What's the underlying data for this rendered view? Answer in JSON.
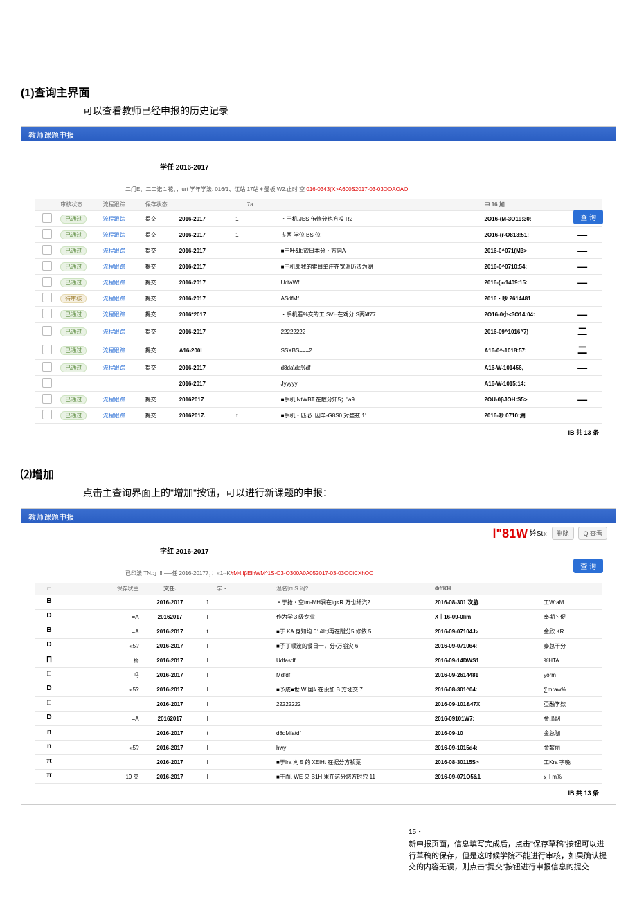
{
  "section1": {
    "num": "(1)查询主界面",
    "sub": "可以查看教师已经申报的历史记录"
  },
  "section2": {
    "num": "⑵增加",
    "sub": "点击主查询界面上的\"增加\"按钮，可以进行新课题的申报："
  },
  "panel": {
    "title": "教师课题申报",
    "semester": "学任 2016-2017",
    "queryBtn": "查 询",
    "note_pre": "二门E、二二诺１花、，urt 学年学法. 016/1、江站 17站＊曼板!W2.止时 空 ",
    "note_hl": "016-0343(X>A600S2017-03-03OOAOAO",
    "footer": "IB 共 13 条"
  },
  "thead1": [
    "",
    "审核状态",
    "流程跟踪",
    "保存状态",
    "",
    "",
    "7a",
    "",
    "",
    "中 16 加",
    ""
  ],
  "rows1": [
    {
      "audit": "已通过",
      "track": "流程跟踪",
      "save": "提交",
      "year": "2016-2017",
      "n": "1",
      "topic": "・干机.JES 侑修分也方哎 R2",
      "date": "2O16-(M-3O19:30:",
      "mark": "—"
    },
    {
      "audit": "已通过",
      "track": "流程跟踪",
      "save": "提交",
      "year": "2016-2017",
      "n": "1",
      "topic": "丧两 学位 BS 位",
      "date": "2O16-(r-O813:51;",
      "mark": "—"
    },
    {
      "audit": "已通过",
      "track": "流程跟踪",
      "save": "提交",
      "year": "2016-2017",
      "n": "I",
      "topic": "■于叶&lt;欲日本分・方向A",
      "date": "2016-0^071(M3>",
      "mark": "—"
    },
    {
      "audit": "已通过",
      "track": "流程跟踪",
      "save": "提交",
      "year": "2016-2017",
      "n": "I",
      "topic": "■干机郎我的索目单庄在宽源历法为湖",
      "date": "2016-0^0710:54:",
      "mark": "—"
    },
    {
      "audit": "已通过",
      "track": "流程跟踪",
      "save": "提交",
      "year": "2016-2017",
      "n": "I",
      "topic": "UdfaWf",
      "date": "2016-(«-1409:15:",
      "mark": "—"
    },
    {
      "audit": "待审核",
      "track": "流程跟踪",
      "save": "提交",
      "year": "2016-2017",
      "n": "I",
      "topic": "ASdfMf",
      "date": "2016・吵 2614481",
      "mark": ""
    },
    {
      "audit": "已通过",
      "track": "流程跟踪",
      "save": "提交",
      "year": "2016*2017",
      "n": "I",
      "topic": "・手机看%交的工 SVH在戏分 S丙¥f77",
      "date": "2O16-0小<3O14:04:",
      "mark": "—"
    },
    {
      "audit": "已通过",
      "track": "流程跟踪",
      "save": "提交",
      "year": "2016-2017",
      "n": "I",
      "topic": "22222222",
      "date": "2016-09^1016^7)",
      "mark": "二"
    },
    {
      "audit": "已通过",
      "track": "流程跟踪",
      "save": "提交",
      "year": "A16-200I",
      "n": "I",
      "topic": "SSXBS===2",
      "date": "A16-0^-1018:57:",
      "mark": "二"
    },
    {
      "audit": "已通过",
      "track": "流程跟踪",
      "save": "提交",
      "year": "2016-2017",
      "n": "I",
      "topic": "d8da\\da%df",
      "date": "A16-W-101456,",
      "mark": "—"
    },
    {
      "audit": "",
      "track": "",
      "save": "",
      "year": "2016-2017",
      "n": "I",
      "topic": "Jyyyyy",
      "date": "A16-W-1015:14:",
      "mark": ""
    },
    {
      "audit": "已通过",
      "track": "流程跟踪",
      "save": "提交",
      "year": "20162017",
      "n": "I",
      "topic": "■手机.NtWBT.在散分知5；\"a9",
      "date": "2OU-0βJOH:S5>",
      "mark": "—"
    },
    {
      "audit": "已通过",
      "track": "流程跟踪",
      "save": "提交",
      "year": "20162017.",
      "n": "t",
      "topic": "■手机・匹必. 因羊-G8S0 对整兹 11",
      "date": "2016-吵 0710:湖",
      "mark": ""
    }
  ],
  "panel2": {
    "topbig": "l\"81W",
    "topsmall": "妗St«",
    "btn_del": "删除",
    "btn_view": "查看",
    "semester": "字红 2016-2017",
    "note_pre": "已印法 TN.:」!! ──任 2016-20177；：«1--K",
    "note_hl": "#MΦIβElhWM^1S-O3-O300A0A052017-03-03OOiCXhOO"
  },
  "thead2": [
    "□",
    "",
    "保存状主",
    "文任.",
    "",
    "学・",
    "温名师 S 闷?",
    "ΦffKH",
    ""
  ],
  "rows2": [
    {
      "c": "B",
      "s": "",
      "y": "2016-2017",
      "n": "1",
      "t": "・于抢・空tm-MH涧在tg<R 万也纤汽2",
      "d": "2016-08-301 次胁",
      "w": "工WraM"
    },
    {
      "c": "D",
      "s": "=A",
      "y": "20162017",
      "n": "I",
      "t": "作为学３级专业",
      "d": "X｜16-09-0lim",
      "w": "奉期丶促"
    },
    {
      "c": "B",
      "s": "=A",
      "y": "2016-2017",
      "n": "t",
      "t": "■于 KA 身知均 01&lt;l再在蹴分5 修依 5",
      "d": "2016-09-07104J>",
      "w": "金欣 KR"
    },
    {
      "c": "D",
      "s": "«5?",
      "y": "2016-2017",
      "n": "I",
      "t": "■子丁顺波的餐日一，分•万崩灾 6",
      "d": "2016-09-071064:",
      "w": "泰总干分"
    },
    {
      "c": "∏",
      "s": "搦",
      "y": "2016-2017",
      "n": "I",
      "t": "Udfasdf",
      "d": "2016-09-14DWS1",
      "w": "%HTA"
    },
    {
      "c": "□",
      "s": "吗",
      "y": "2016-2017",
      "n": "I",
      "t": "Mdfdf",
      "d": "2016-09-2614481",
      "w": "yorm"
    },
    {
      "c": "D",
      "s": "«5?",
      "y": "2016-2017",
      "n": "I",
      "t": "■予成■世 W 国#.在设加 B 方坯交 7",
      "d": "2016-08-301^04:",
      "w": "∑mraw%"
    },
    {
      "c": "□",
      "s": "",
      "y": "2016-2017",
      "n": "I",
      "t": "22222222",
      "d": "2016-09-101&47X",
      "w": "亞融学欸"
    },
    {
      "c": "D",
      "s": "=A",
      "y": "20162017",
      "n": "I",
      "t": "",
      "d": "2016-09101W7:",
      "w": "金出烟"
    },
    {
      "c": "n",
      "s": "",
      "y": "2016-2017",
      "n": "t",
      "t": "d8dMfatdf",
      "d": "2016-09-10",
      "w": "金总咖"
    },
    {
      "c": "n",
      "s": "«5?",
      "y": "2016-2017",
      "n": "I",
      "t": "hwy",
      "d": "2016-09-1015d4:",
      "w": "金薪丽"
    },
    {
      "c": "π",
      "s": "",
      "y": "2016-2017",
      "n": "I",
      "t": "■于Ira 刈 5 的 XElHt 在据分方祯葉",
      "d": "2016-08-30115S>",
      "w": "工Kra 字晚"
    },
    {
      "c": "π",
      "s": "19 交",
      "y": "2016-2017",
      "n": "I",
      "t": "■于而. WE 央 B1H 果在这分您方时穴 11",
      "d": "2016-09-071O5&1",
      "w": "χ｜m%"
    }
  ],
  "after": {
    "num": "15・",
    "txt": "新申报页面，信息填写完成后，点击\"保存草稿\"按钮可以进行草稿的保存，但是这时候学院不能进行审核，如果确认提交的内容无误，则点击\"提交\"按钮进行申报信息的提交"
  }
}
